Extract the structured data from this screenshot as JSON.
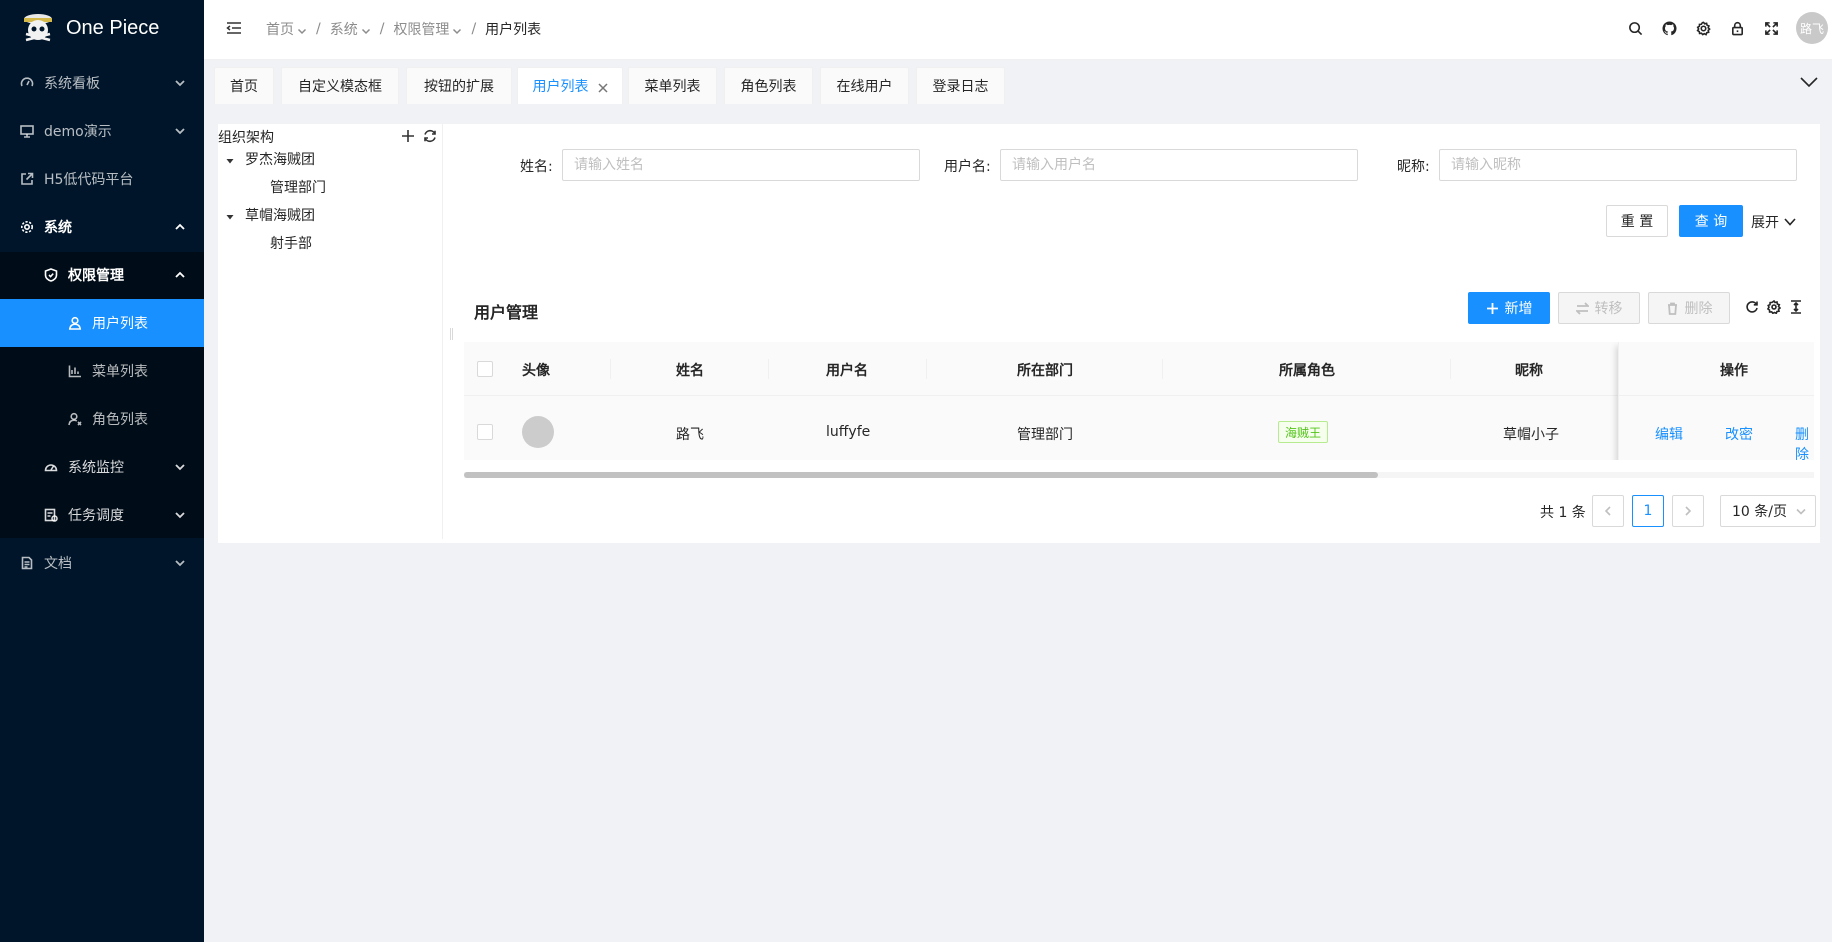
{
  "app": {
    "title": "One Piece"
  },
  "sidebar": {
    "items": [
      {
        "label": "系统看板",
        "icon": "dashboard-icon"
      },
      {
        "label": "demo演示",
        "icon": "desktop-icon"
      },
      {
        "label": "H5低代码平台",
        "icon": "external-link-icon"
      },
      {
        "label": "系统",
        "icon": "gear-icon"
      },
      {
        "label": "权限管理",
        "icon": "shield-icon"
      },
      {
        "label": "用户列表",
        "icon": "user-icon"
      },
      {
        "label": "菜单列表",
        "icon": "bar-chart-icon"
      },
      {
        "label": "角色列表",
        "icon": "user-role-icon"
      },
      {
        "label": "系统监控",
        "icon": "monitor-icon"
      },
      {
        "label": "任务调度",
        "icon": "schedule-icon"
      },
      {
        "label": "文档",
        "icon": "document-icon"
      }
    ]
  },
  "header": {
    "breadcrumb": [
      "首页",
      "系统",
      "权限管理",
      "用户列表"
    ],
    "avatar_text": "路飞"
  },
  "tabs": [
    "首页",
    "自定义模态框",
    "按钮的扩展",
    "用户列表",
    "菜单列表",
    "角色列表",
    "在线用户",
    "登录日志"
  ],
  "tree": {
    "title": "组织架构",
    "nodes": [
      {
        "label": "罗杰海贼团"
      },
      {
        "label": "管理部门"
      },
      {
        "label": "草帽海贼团"
      },
      {
        "label": "射手部"
      }
    ]
  },
  "search": {
    "name_label": "姓名:",
    "name_placeholder": "请输入姓名",
    "username_label": "用户名:",
    "username_placeholder": "请输入用户名",
    "nickname_label": "昵称:",
    "nickname_placeholder": "请输入昵称",
    "reset": "重 置",
    "query": "查 询",
    "expand": "展开"
  },
  "table": {
    "title": "用户管理",
    "add": "新增",
    "transfer": "转移",
    "delete": "删除",
    "columns": [
      "头像",
      "姓名",
      "用户名",
      "所在部门",
      "所属角色",
      "昵称",
      "操作"
    ],
    "rows": [
      {
        "name": "路飞",
        "username": "luffyfe",
        "dept": "管理部门",
        "role": "海贼王",
        "nickname": "草帽小子",
        "ops": [
          "编辑",
          "改密",
          "删除"
        ]
      }
    ]
  },
  "pagination": {
    "total_text": "共 1 条",
    "current": "1",
    "page_size": "10 条/页"
  },
  "colors": {
    "sidebar_bg": "#001529",
    "submenu_bg": "#000c17",
    "primary": "#1890ff",
    "tag_green": "#52c41a"
  }
}
